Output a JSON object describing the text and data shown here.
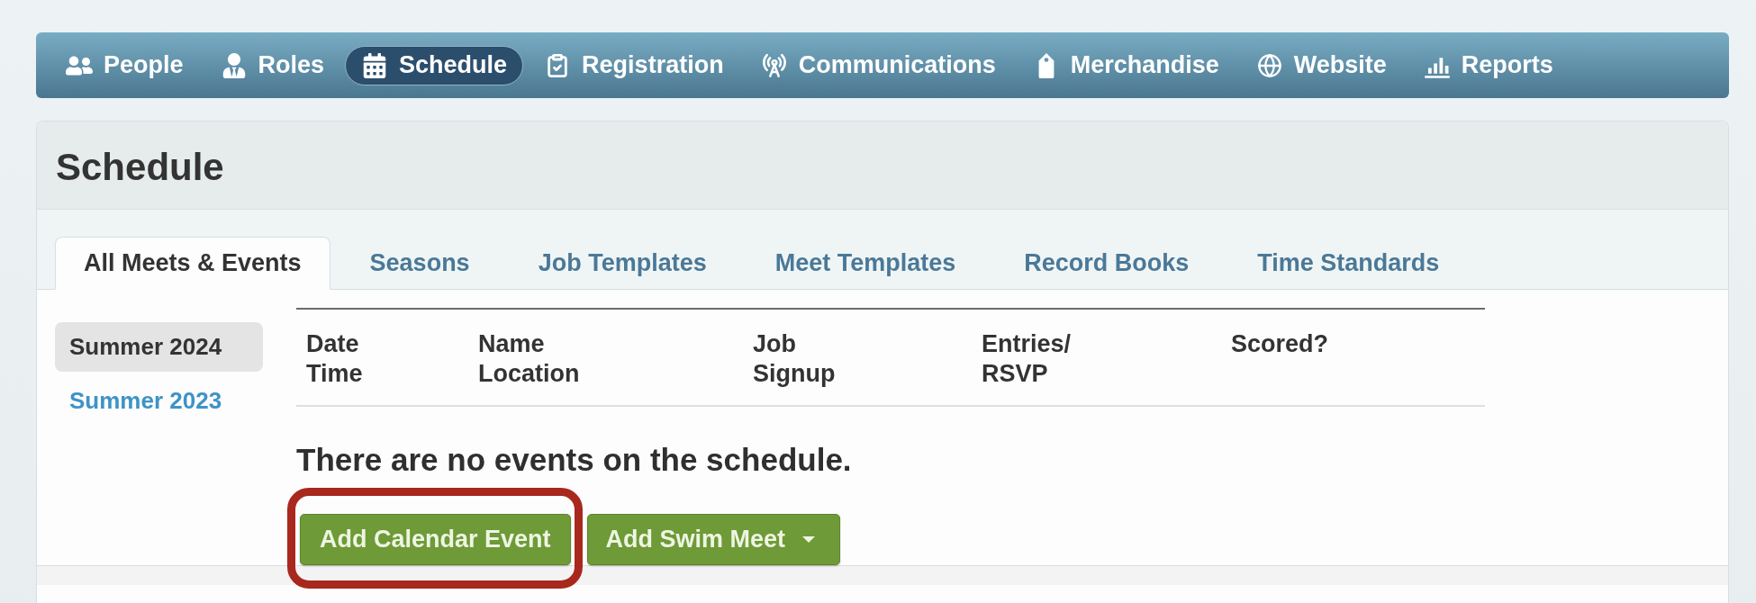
{
  "nav": {
    "items": [
      {
        "label": "People",
        "selected": false
      },
      {
        "label": "Roles",
        "selected": false
      },
      {
        "label": "Schedule",
        "selected": true
      },
      {
        "label": "Registration",
        "selected": false
      },
      {
        "label": "Communications",
        "selected": false
      },
      {
        "label": "Merchandise",
        "selected": false
      },
      {
        "label": "Website",
        "selected": false
      },
      {
        "label": "Reports",
        "selected": false
      }
    ]
  },
  "page_title": "Schedule",
  "tabs": [
    {
      "label": "All Meets & Events",
      "selected": true
    },
    {
      "label": "Seasons",
      "selected": false
    },
    {
      "label": "Job Templates",
      "selected": false
    },
    {
      "label": "Meet Templates",
      "selected": false
    },
    {
      "label": "Record Books",
      "selected": false
    },
    {
      "label": "Time Standards",
      "selected": false
    }
  ],
  "sidebar": {
    "seasons": [
      {
        "label": "Summer 2024",
        "selected": true
      },
      {
        "label": "Summer 2023",
        "selected": false
      }
    ]
  },
  "table": {
    "columns": [
      "Date\nTime",
      "Name\nLocation",
      "Job\nSignup",
      "Entries/\nRSVP",
      "Scored?"
    ]
  },
  "empty_message": "There are no events on the schedule.",
  "buttons": [
    {
      "label": "Add Calendar Event",
      "kind": "button",
      "highlighted": true
    },
    {
      "label": "Add Swim Meet",
      "kind": "dropdown",
      "highlighted": false
    }
  ]
}
